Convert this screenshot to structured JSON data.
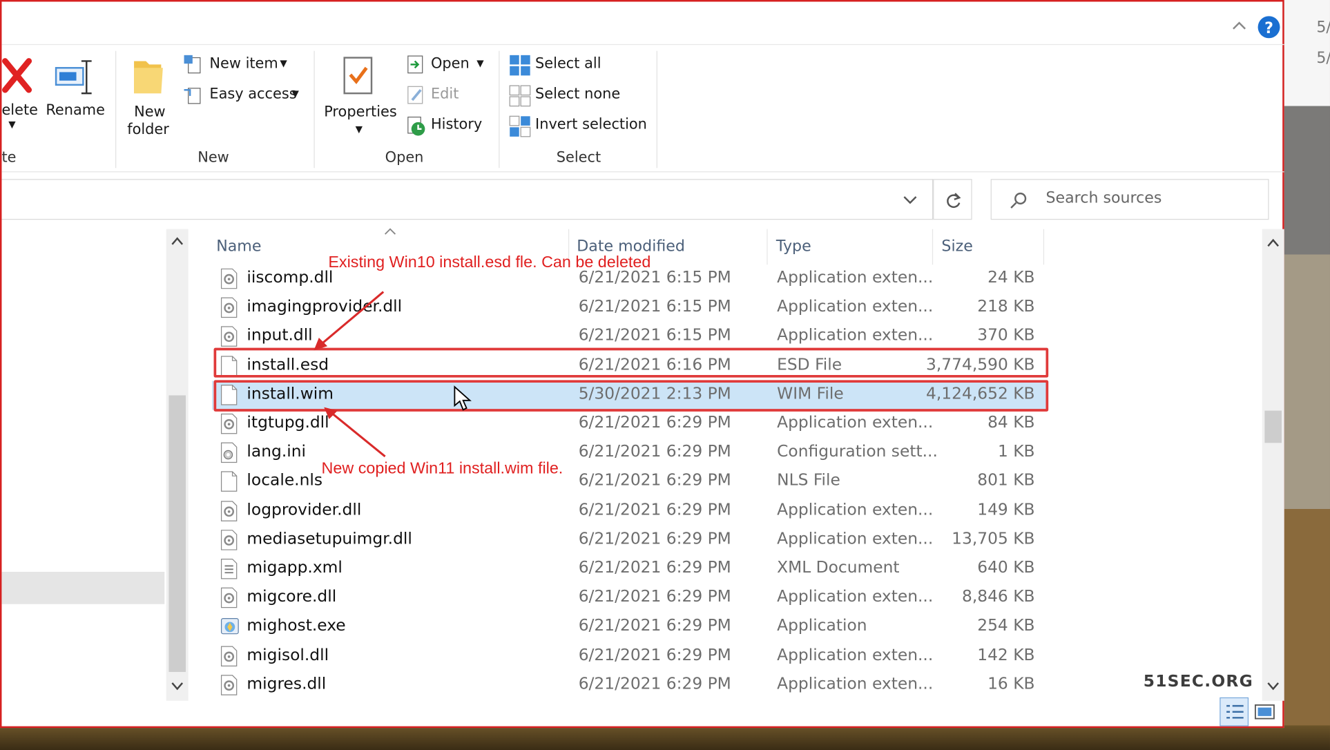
{
  "ribbon": {
    "delete_label": "elete",
    "rename_label": "Rename",
    "new_folder_label_1": "New",
    "new_folder_label_2": "folder",
    "new_item_label": "New item",
    "easy_access_label": "Easy access",
    "group_new": "New",
    "properties_label": "Properties",
    "open_label": "Open",
    "edit_label": "Edit",
    "history_label": "History",
    "group_open": "Open",
    "select_all_label": "Select all",
    "select_none_label": "Select none",
    "invert_selection_label": "Invert selection",
    "group_select": "Select",
    "left_group_fragment": "te"
  },
  "search": {
    "placeholder": "Search sources"
  },
  "columns": {
    "name": "Name",
    "date": "Date modified",
    "type": "Type",
    "size": "Size"
  },
  "files": [
    {
      "name": "iiscomp.dll",
      "date": "6/21/2021 6:15 PM",
      "type": "Application exten...",
      "size": "24 KB",
      "icon": "dll"
    },
    {
      "name": "imagingprovider.dll",
      "date": "6/21/2021 6:15 PM",
      "type": "Application exten...",
      "size": "218 KB",
      "icon": "dll"
    },
    {
      "name": "input.dll",
      "date": "6/21/2021 6:15 PM",
      "type": "Application exten...",
      "size": "370 KB",
      "icon": "dll"
    },
    {
      "name": "install.esd",
      "date": "6/21/2021 6:16 PM",
      "type": "ESD File",
      "size": "3,774,590 KB",
      "icon": "file"
    },
    {
      "name": "install.wim",
      "date": "5/30/2021 2:13 PM",
      "type": "WIM File",
      "size": "4,124,652 KB",
      "icon": "file",
      "selected": true
    },
    {
      "name": "itgtupg.dll",
      "date": "6/21/2021 6:29 PM",
      "type": "Application exten...",
      "size": "84 KB",
      "icon": "dll"
    },
    {
      "name": "lang.ini",
      "date": "6/21/2021 6:29 PM",
      "type": "Configuration sett...",
      "size": "1 KB",
      "icon": "ini"
    },
    {
      "name": "locale.nls",
      "date": "6/21/2021 6:29 PM",
      "type": "NLS File",
      "size": "801 KB",
      "icon": "file"
    },
    {
      "name": "logprovider.dll",
      "date": "6/21/2021 6:29 PM",
      "type": "Application exten...",
      "size": "149 KB",
      "icon": "dll"
    },
    {
      "name": "mediasetupuimgr.dll",
      "date": "6/21/2021 6:29 PM",
      "type": "Application exten...",
      "size": "13,705 KB",
      "icon": "dll"
    },
    {
      "name": "migapp.xml",
      "date": "6/21/2021 6:29 PM",
      "type": "XML Document",
      "size": "640 KB",
      "icon": "xml"
    },
    {
      "name": "migcore.dll",
      "date": "6/21/2021 6:29 PM",
      "type": "Application exten...",
      "size": "8,846 KB",
      "icon": "dll"
    },
    {
      "name": "mighost.exe",
      "date": "6/21/2021 6:29 PM",
      "type": "Application",
      "size": "254 KB",
      "icon": "exe"
    },
    {
      "name": "migisol.dll",
      "date": "6/21/2021 6:29 PM",
      "type": "Application exten...",
      "size": "142 KB",
      "icon": "dll"
    },
    {
      "name": "migres.dll",
      "date": "6/21/2021 6:29 PM",
      "type": "Application exten...",
      "size": "16 KB",
      "icon": "dll"
    }
  ],
  "annotations": {
    "esd_note": "Existing Win10 install.esd fle. Can be deleted",
    "wim_note": "New copied Win11 install.wim file."
  },
  "watermark": "51SEC.ORG",
  "desk_fragments": [
    "5/",
    "5/"
  ],
  "colors": {
    "selection": "#cce4f7",
    "annotation": "#e02020",
    "border": "#d62020"
  }
}
